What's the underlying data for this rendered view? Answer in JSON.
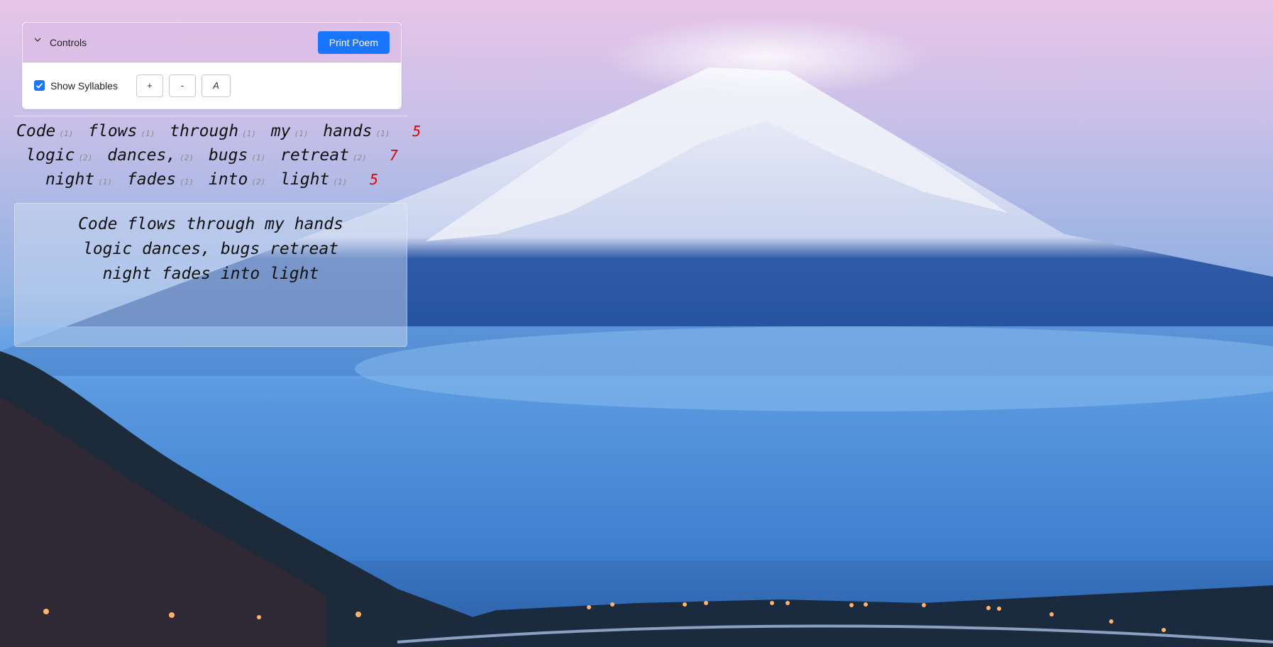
{
  "controls": {
    "title": "Controls",
    "print_label": "Print Poem",
    "show_syllables_label": "Show Syllables",
    "show_syllables_checked": true,
    "increase_label": "+",
    "decrease_label": "-",
    "font_label": "A"
  },
  "syllable_lines": [
    {
      "words": [
        {
          "text": "Code",
          "count": "(1)"
        },
        {
          "text": "flows",
          "count": "(1)"
        },
        {
          "text": "through",
          "count": "(1)"
        },
        {
          "text": "my",
          "count": "(1)"
        },
        {
          "text": "hands",
          "count": "(1)"
        }
      ],
      "total": "5"
    },
    {
      "words": [
        {
          "text": "logic",
          "count": "(2)"
        },
        {
          "text": "dances,",
          "count": "(2)"
        },
        {
          "text": "bugs",
          "count": "(1)"
        },
        {
          "text": "retreat",
          "count": "(2)"
        }
      ],
      "total": "7"
    },
    {
      "words": [
        {
          "text": "night",
          "count": "(1)"
        },
        {
          "text": "fades",
          "count": "(1)"
        },
        {
          "text": "into",
          "count": "(2)"
        },
        {
          "text": "light",
          "count": "(1)"
        }
      ],
      "total": "5"
    }
  ],
  "poem": {
    "lines": [
      "Code flows through my hands",
      "logic dances, bugs retreat",
      "night fades into light"
    ]
  },
  "colors": {
    "accent": "#1a75ff",
    "total_count": "#e00000"
  },
  "icons": {
    "chevron": "chevron-down-icon",
    "checkbox": "checkmark-icon"
  }
}
